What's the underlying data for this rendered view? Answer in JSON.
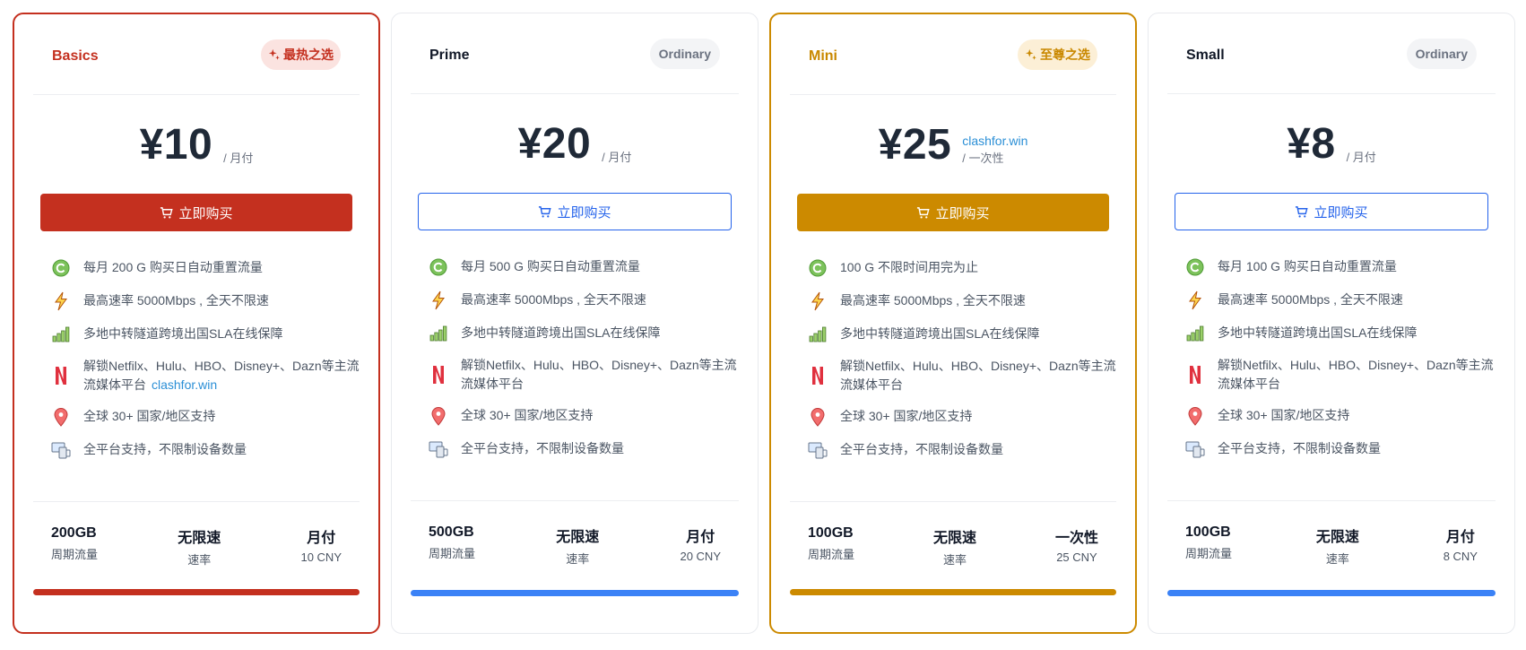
{
  "plans": [
    {
      "name": "Basics",
      "badge": "最热之选",
      "amount": "¥10",
      "promo": "",
      "period": "/ 月付",
      "buy_label": "立即购买",
      "features": [
        "每月 200 G 购买日自动重置流量",
        "最高速率 5000Mbps , 全天不限速",
        "多地中转隧道跨境出国SLA在线保障",
        "解锁Netfilx、Hulu、HBO、Disney+、Dazn等主流流媒体平台",
        "全球 30+ 国家/地区支持",
        "全平台支持，不限制设备数量"
      ],
      "feature_promo": "clashfor.win",
      "stats": [
        {
          "value": "200GB",
          "label": "周期流量"
        },
        {
          "value": "无限速",
          "label": "速率"
        },
        {
          "value": "月付",
          "label": "10 CNY"
        }
      ]
    },
    {
      "name": "Prime",
      "badge": "Ordinary",
      "amount": "¥20",
      "promo": "",
      "period": "/ 月付",
      "buy_label": "立即购买",
      "features": [
        "每月 500 G 购买日自动重置流量",
        "最高速率 5000Mbps , 全天不限速",
        "多地中转隧道跨境出国SLA在线保障",
        "解锁Netfilx、Hulu、HBO、Disney+、Dazn等主流流媒体平台",
        "全球 30+ 国家/地区支持",
        "全平台支持，不限制设备数量"
      ],
      "feature_promo": "",
      "stats": [
        {
          "value": "500GB",
          "label": "周期流量"
        },
        {
          "value": "无限速",
          "label": "速率"
        },
        {
          "value": "月付",
          "label": "20 CNY"
        }
      ]
    },
    {
      "name": "Mini",
      "badge": "至尊之选",
      "amount": "¥25",
      "promo": "clashfor.win",
      "period": "/ 一次性",
      "buy_label": "立即购买",
      "features": [
        "100 G 不限时间用完为止",
        "最高速率 5000Mbps , 全天不限速",
        "多地中转隧道跨境出国SLA在线保障",
        "解锁Netfilx、Hulu、HBO、Disney+、Dazn等主流流媒体平台",
        "全球 30+ 国家/地区支持",
        "全平台支持，不限制设备数量"
      ],
      "feature_promo": "",
      "stats": [
        {
          "value": "100GB",
          "label": "周期流量"
        },
        {
          "value": "无限速",
          "label": "速率"
        },
        {
          "value": "一次性",
          "label": "25 CNY"
        }
      ]
    },
    {
      "name": "Small",
      "badge": "Ordinary",
      "amount": "¥8",
      "promo": "",
      "period": "/ 月付",
      "buy_label": "立即购买",
      "features": [
        "每月 100 G 购买日自动重置流量",
        "最高速率 5000Mbps , 全天不限速",
        "多地中转隧道跨境出国SLA在线保障",
        "解锁Netfilx、Hulu、HBO、Disney+、Dazn等主流流媒体平台",
        "全球 30+ 国家/地区支持",
        "全平台支持，不限制设备数量"
      ],
      "feature_promo": "",
      "stats": [
        {
          "value": "100GB",
          "label": "周期流量"
        },
        {
          "value": "无限速",
          "label": "速率"
        },
        {
          "value": "月付",
          "label": "8 CNY"
        }
      ]
    }
  ],
  "feature_icons": [
    "reset-icon",
    "lightning-icon",
    "signal-bars-icon",
    "netflix-icon",
    "location-pin-icon",
    "devices-icon"
  ],
  "colors": {
    "hot": "#c4301f",
    "gold": "#cc8a00",
    "ordinary": "#3b82f6"
  }
}
